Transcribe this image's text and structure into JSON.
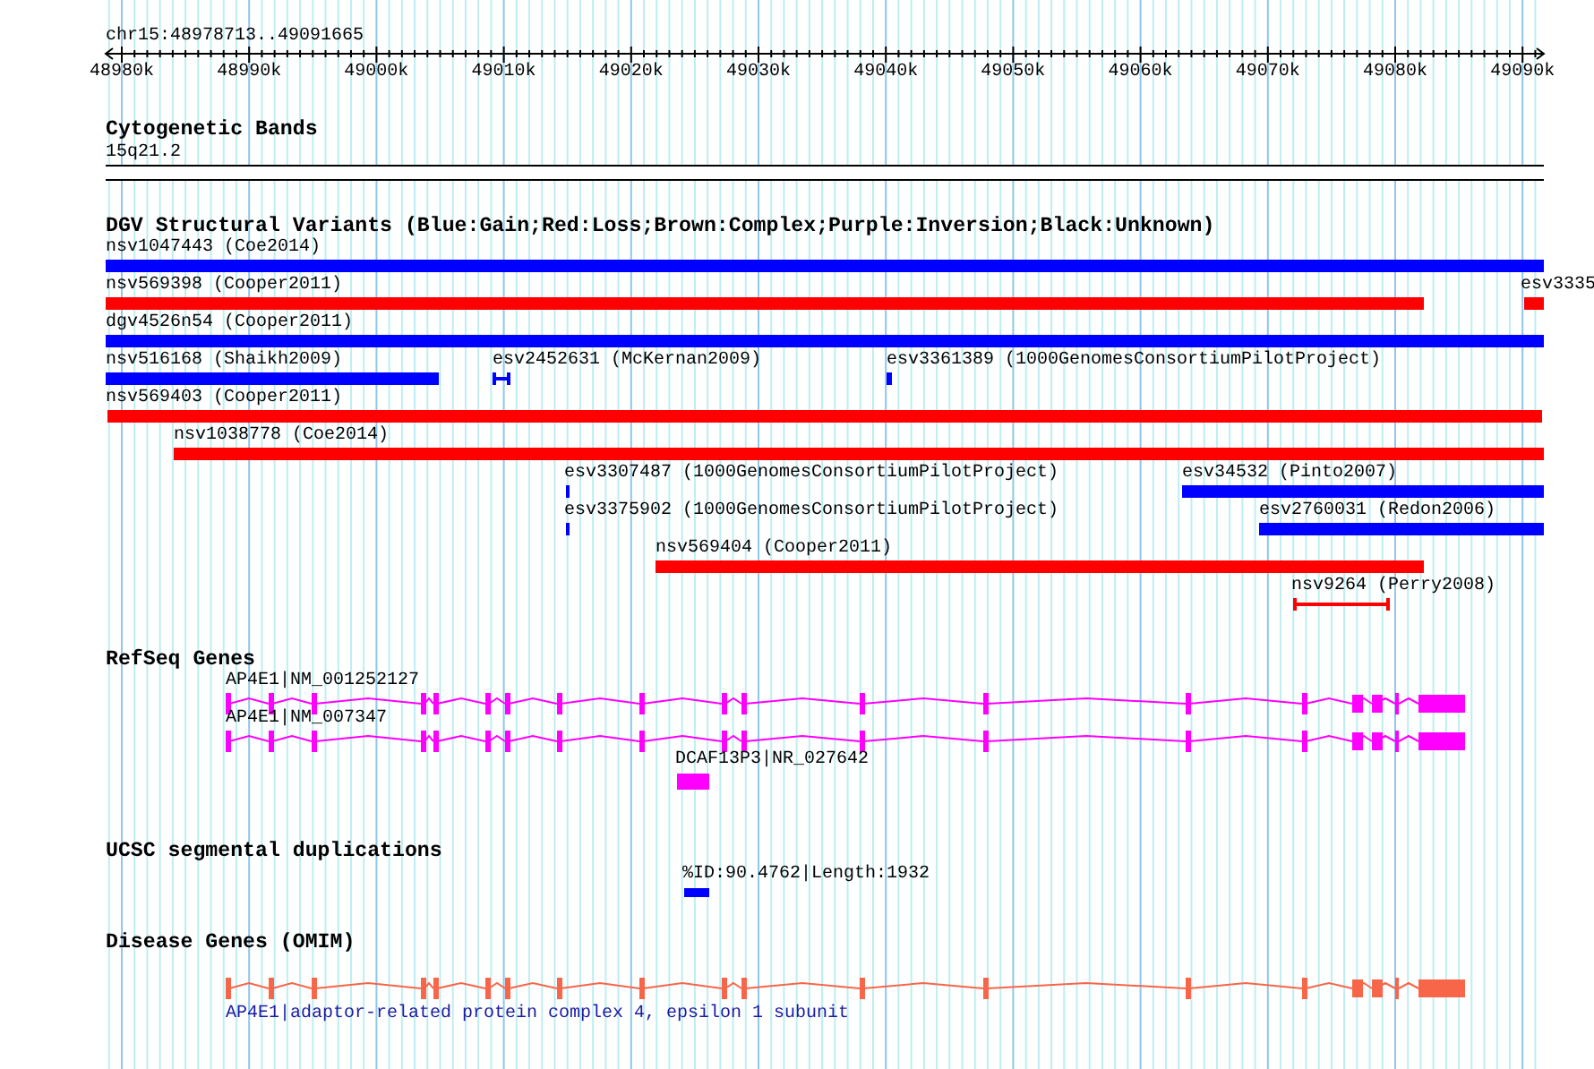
{
  "ruler": {
    "region": "chr15:48978713..49091665",
    "ticks": [
      "48980k",
      "48990k",
      "49000k",
      "49010k",
      "49020k",
      "49030k",
      "49040k",
      "49050k",
      "49060k",
      "49070k",
      "49080k",
      "49090k"
    ]
  },
  "tracks": [
    {
      "kind": "cytoband",
      "title": "Cytogenetic Bands",
      "band": "15q21.2"
    },
    {
      "kind": "variants",
      "title": "DGV Structural Variants (Blue:Gain;Red:Loss;Brown:Complex;Purple:Inversion;Black:Unknown)",
      "features": [
        {
          "label": "nsv1047443 (Coe2014)",
          "color": "#0000ff",
          "kind": "bar"
        },
        {
          "label": "nsv569398 (Cooper2011)",
          "color": "#ff0000",
          "kind": "bar"
        },
        {
          "label": "esv3335",
          "color": "#ff0000",
          "kind": "bar"
        },
        {
          "label": "dgv4526n54 (Cooper2011)",
          "color": "#0000ff",
          "kind": "bar"
        },
        {
          "label": "nsv516168 (Shaikh2009)",
          "color": "#0000ff",
          "kind": "bar"
        },
        {
          "label": "esv2452631 (McKernan2009)",
          "color": "#0000ff",
          "kind": "interval"
        },
        {
          "label": "esv3361389 (1000GenomesConsortiumPilotProject)",
          "color": "#0000ff",
          "kind": "bar"
        },
        {
          "label": "nsv569403 (Cooper2011)",
          "color": "#ff0000",
          "kind": "bar"
        },
        {
          "label": "nsv1038778 (Coe2014)",
          "color": "#ff0000",
          "kind": "bar"
        },
        {
          "label": "esv3307487 (1000GenomesConsortiumPilotProject)",
          "color": "#0000ff",
          "kind": "bar"
        },
        {
          "label": "esv34532 (Pinto2007)",
          "color": "#0000ff",
          "kind": "bar"
        },
        {
          "label": "esv3375902 (1000GenomesConsortiumPilotProject)",
          "color": "#0000ff",
          "kind": "bar"
        },
        {
          "label": "esv2760031 (Redon2006)",
          "color": "#0000ff",
          "kind": "bar"
        },
        {
          "label": "nsv569404 (Cooper2011)",
          "color": "#ff0000",
          "kind": "bar"
        },
        {
          "label": "nsv9264 (Perry2008)",
          "color": "#ff0000",
          "kind": "interval"
        }
      ]
    },
    {
      "kind": "genes",
      "title": "RefSeq Genes",
      "features": [
        {
          "label": "AP4E1|NM_001252127",
          "kind": "transcript"
        },
        {
          "label": "AP4E1|NM_007347",
          "kind": "transcript"
        },
        {
          "label": "DCAF13P3|NR_027642",
          "kind": "block"
        }
      ]
    },
    {
      "kind": "segdups",
      "title": "UCSC segmental duplications",
      "features": [
        {
          "label": "%ID:90.4762|Length:1932"
        }
      ]
    },
    {
      "kind": "disease",
      "title": "Disease Genes (OMIM)",
      "features": [
        {
          "label": "AP4E1|adaptor-related protein complex 4, epsilon 1 subunit"
        }
      ]
    }
  ]
}
